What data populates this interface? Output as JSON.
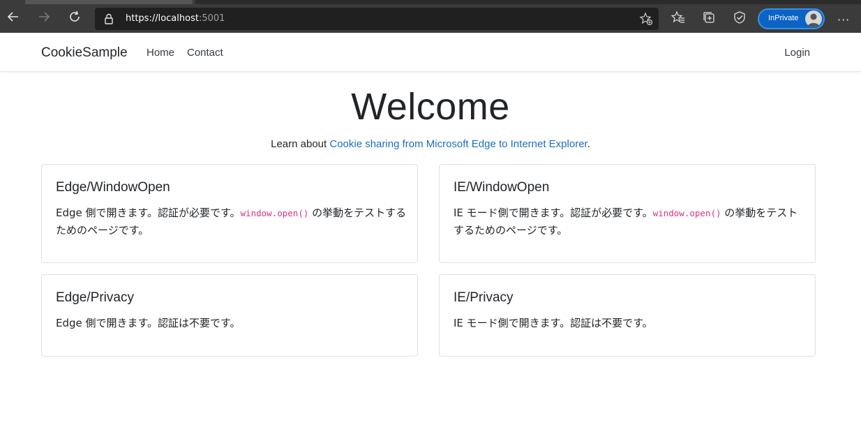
{
  "browser": {
    "url_host": "https://localhost",
    "url_port": ":5001",
    "inprivate_label": "InPrivate",
    "more_label": "···"
  },
  "navbar": {
    "brand": "CookieSample",
    "links": [
      "Home",
      "Contact"
    ],
    "login": "Login"
  },
  "hero": {
    "title": "Welcome",
    "sub_prefix": "Learn about ",
    "sub_link": "Cookie sharing from Microsoft Edge to Internet Explorer",
    "sub_suffix": "."
  },
  "cards": [
    {
      "title": "Edge/WindowOpen",
      "text_before": "Edge 側で開きます。認証が必要です。",
      "code": "window.open()",
      "text_after": " の挙動をテストするためのページです。"
    },
    {
      "title": "IE/WindowOpen",
      "text_before": "IE モード側で開きます。認証が必要です。",
      "code": "window.open()",
      "text_after": " の挙動をテストするためのページです。"
    },
    {
      "title": "Edge/Privacy",
      "text": "Edge 側で開きます。認証は不要です。"
    },
    {
      "title": "IE/Privacy",
      "text": "IE モード側で開きます。認証は不要です。"
    }
  ],
  "colors": {
    "link": "#1b6ec2",
    "code": "#d63384",
    "chrome": "#3b3b3b"
  }
}
